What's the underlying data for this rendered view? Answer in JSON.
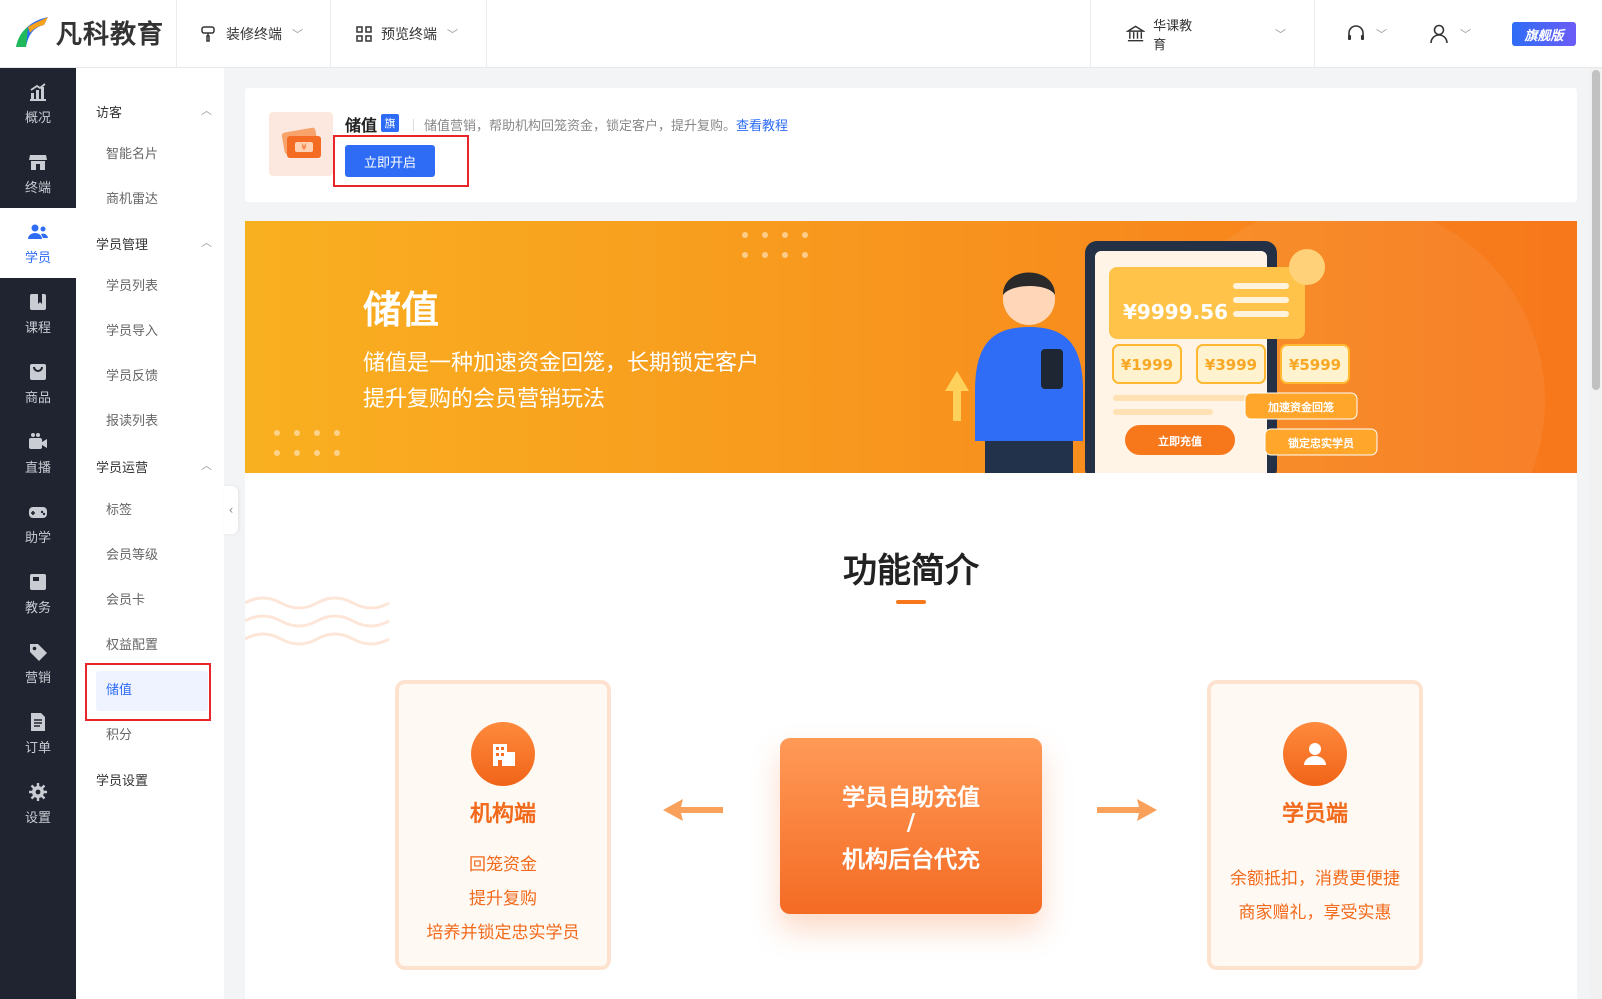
{
  "brand": {
    "name": "凡科教育"
  },
  "topbar": {
    "decorate": "装修终端",
    "preview": "预览终端",
    "org": "华课教育",
    "version_badge": "旗舰版"
  },
  "leftnav": [
    {
      "label": "概况",
      "icon": "chart-up-icon"
    },
    {
      "label": "终端",
      "icon": "storefront-icon"
    },
    {
      "label": "学员",
      "icon": "users-icon"
    },
    {
      "label": "课程",
      "icon": "book-icon"
    },
    {
      "label": "商品",
      "icon": "bag-icon"
    },
    {
      "label": "直播",
      "icon": "video-camera-icon"
    },
    {
      "label": "助学",
      "icon": "gamepad-icon"
    },
    {
      "label": "教务",
      "icon": "folder-icon"
    },
    {
      "label": "营销",
      "icon": "tag-icon"
    },
    {
      "label": "订单",
      "icon": "document-icon"
    },
    {
      "label": "设置",
      "icon": "gear-icon"
    }
  ],
  "subnav": {
    "groups": [
      {
        "label": "访客",
        "items": [
          "智能名片",
          "商机雷达"
        ]
      },
      {
        "label": "学员管理",
        "items": [
          "学员列表",
          "学员导入",
          "学员反馈",
          "报读列表"
        ]
      },
      {
        "label": "学员运营",
        "items": [
          "标签",
          "会员等级",
          "会员卡",
          "权益配置",
          "储值",
          "积分"
        ]
      },
      {
        "label": "学员设置",
        "items": []
      }
    ]
  },
  "app": {
    "title": "储值",
    "flag": "旗",
    "desc": "储值营销，帮助机构回笼资金，锁定客户，提升复购。",
    "link": "查看教程",
    "open_button": "立即开启"
  },
  "banner": {
    "title": "储值",
    "line1": "储值是一种加速资金回笼，长期锁定客户",
    "line2": "提升复购的会员营销玩法",
    "balance": "¥9999.56",
    "options": [
      "¥1999",
      "¥3999",
      "¥5999"
    ],
    "recharge_btn": "立即充值",
    "tag1": "加速资金回笼",
    "tag2": "锁定忠实学员"
  },
  "intro": {
    "title": "功能简介",
    "left": {
      "title": "机构端",
      "lines": [
        "回笼资金",
        "提升复购",
        "培养并锁定忠实学员"
      ]
    },
    "center": {
      "line1": "学员自助充值",
      "line2": "/",
      "line3": "机构后台代充"
    },
    "right": {
      "title": "学员端",
      "lines": [
        "余额抵扣，消费更便捷",
        "商家赠礼，享受实惠"
      ]
    }
  },
  "colors": {
    "accent": "#2e6cf6",
    "orange": "#f7771b",
    "highlight": "#e8262a"
  }
}
